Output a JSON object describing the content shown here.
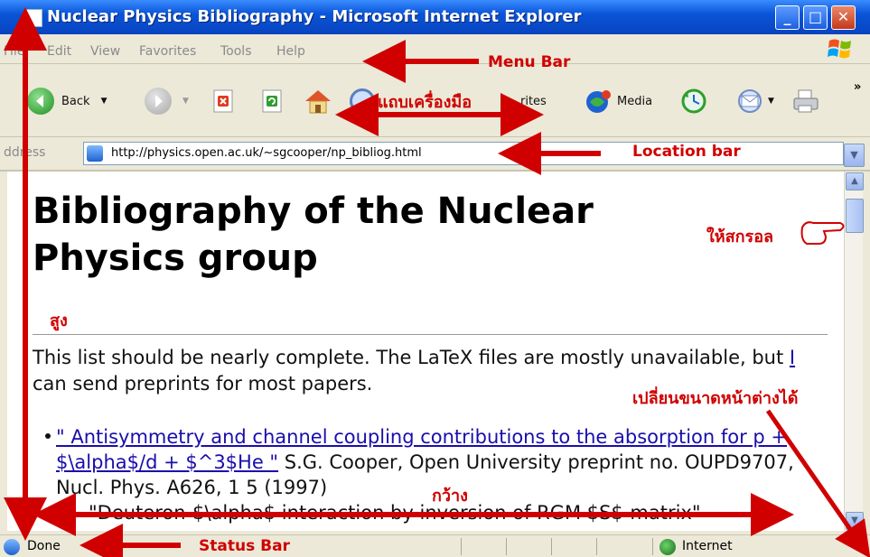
{
  "window": {
    "title": "Nuclear Physics Bibliography - Microsoft Internet Explorer",
    "minimize_glyph": "_",
    "maximize_glyph": "□",
    "close_glyph": "✕"
  },
  "menu": [
    "File",
    "Edit",
    "View",
    "Favorites",
    "Tools",
    "Help"
  ],
  "toolbar": {
    "back_label": "Back",
    "favorites_label": "rites",
    "media_label": "Media",
    "chevron": "»",
    "icons": [
      "back-icon",
      "forward-icon",
      "stop-icon",
      "refresh-icon",
      "home-icon",
      "search-icon",
      "favorites-icon",
      "media-icon",
      "history-icon",
      "mail-icon",
      "print-icon"
    ]
  },
  "address": {
    "label": "ddress",
    "url": "http://physics.open.ac.uk/~sgcooper/np_bibliog.html"
  },
  "page": {
    "heading": "Bibliography of the Nuclear Physics group",
    "intro_before": "This list should be nearly complete. The LaTeX files are mostly unavailable, but ",
    "intro_link": "I",
    "intro_after": " can send preprints for most papers.",
    "item1_link": "\" Antisymmetry and channel coupling contributions to the absorption for p + $\\alpha$/d + $^3$He \"",
    "item1_text": " S.G. Cooper, Open University preprint no. OUPD9707, Nucl. Phys. A626, 1 5 (1997)",
    "item2_text": "\"Deuteron-$\\alpha$ interaction by inversion of RGM $S$-matrix\""
  },
  "status": {
    "text": "Done",
    "zone": "Internet"
  },
  "annotations": {
    "menu_bar": "Menu Bar",
    "toolbar_thai": "แถบเครื่องมือ",
    "location_bar": "Location bar",
    "status_bar": "Status Bar",
    "scroll_thai": "ให้สกรอล",
    "height_thai": "สูง",
    "width_thai": "กว้าง",
    "resize_thai": "เปลี่ยนขนาดหน้าต่างได้"
  },
  "colors": {
    "annotation_red": "#d00000",
    "annotation_blue_text": "#1a2ad0",
    "title_bar": "#0a55d8",
    "link": "#1a0dab"
  }
}
